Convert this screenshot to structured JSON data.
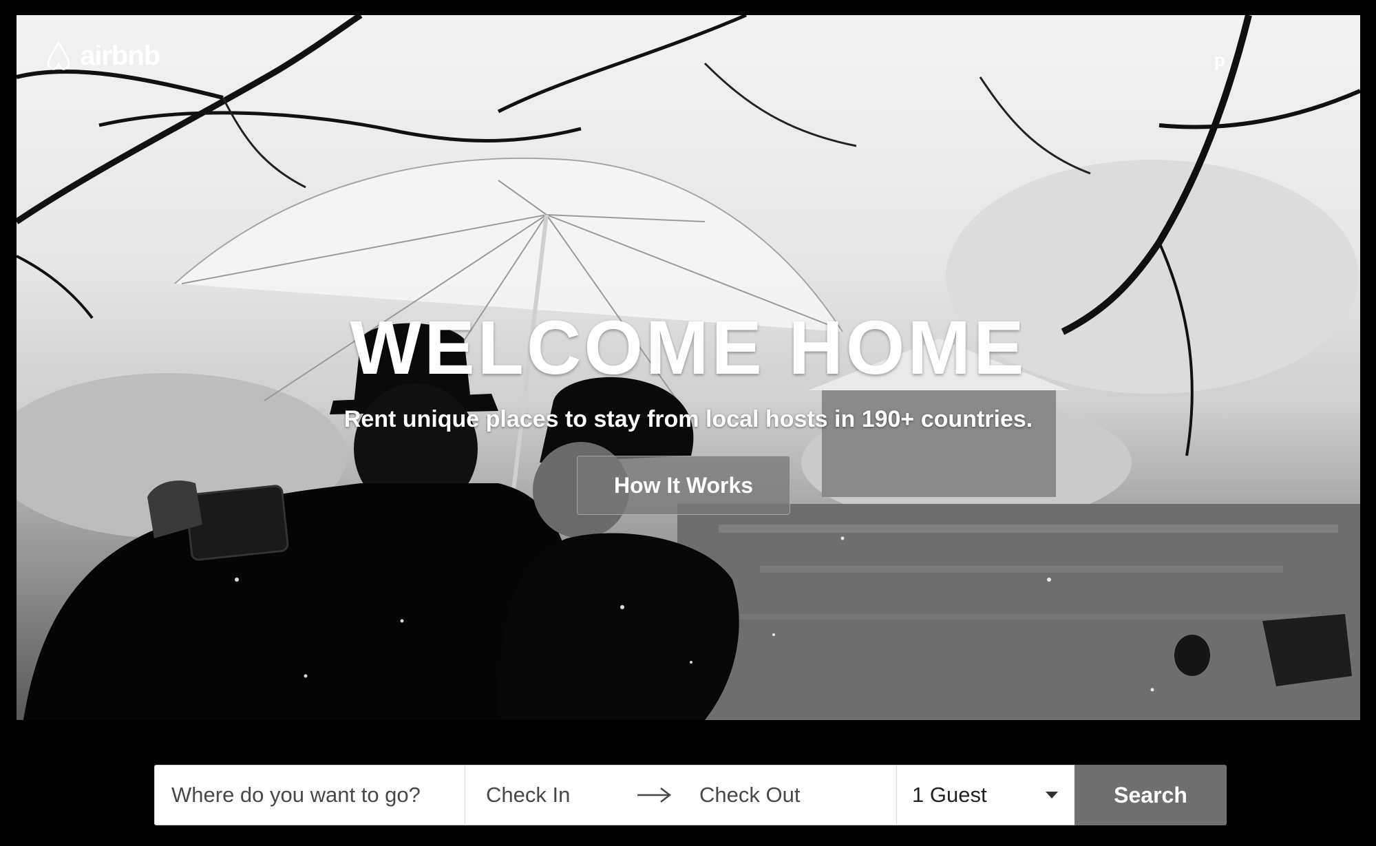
{
  "header": {
    "brand": "airbnb",
    "nav_fragment": "p"
  },
  "hero": {
    "title": "WELCOME HOME",
    "subtitle": "Rent unique places to stay from local hosts in 190+ countries.",
    "cta_label": "How It Works"
  },
  "search": {
    "where_placeholder": "Where do you want to go?",
    "check_in": "Check In",
    "check_out": "Check Out",
    "guests": "1 Guest",
    "button_label": "Search",
    "arrow_icon": "arrow-right-icon",
    "guests_icon": "caret-down-icon"
  },
  "colors": {
    "search_button": "#6f6f6f",
    "field_background": "#ffffff",
    "page_background": "#000000"
  }
}
